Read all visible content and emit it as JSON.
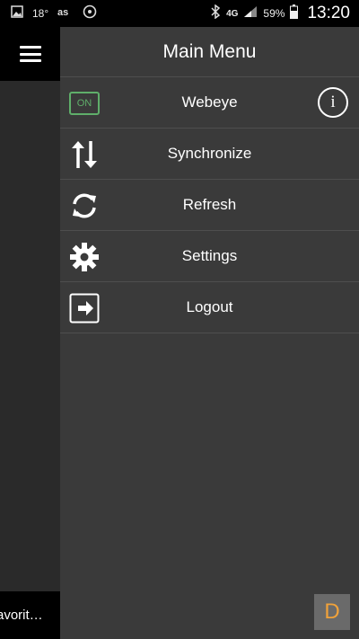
{
  "status_bar": {
    "temperature": "18°",
    "network": "4G",
    "battery": "59%",
    "time": "13:20"
  },
  "app_background": {
    "footer_text": "avorit…"
  },
  "drawer": {
    "title": "Main Menu",
    "items": [
      {
        "label": "Webeye",
        "icon": "on-toggle-icon",
        "badge": "ON",
        "info_icon": "info-icon",
        "info_glyph": "i"
      },
      {
        "label": "Synchronize",
        "icon": "sync-arrows-icon"
      },
      {
        "label": "Refresh",
        "icon": "refresh-icon"
      },
      {
        "label": "Settings",
        "icon": "gear-icon"
      },
      {
        "label": "Logout",
        "icon": "logout-icon"
      }
    ]
  },
  "corner_badge": {
    "text": "D",
    "color": "#f0a23a"
  },
  "colors": {
    "drawer_bg": "#3a3a3a",
    "on_green": "#5fae6a"
  }
}
